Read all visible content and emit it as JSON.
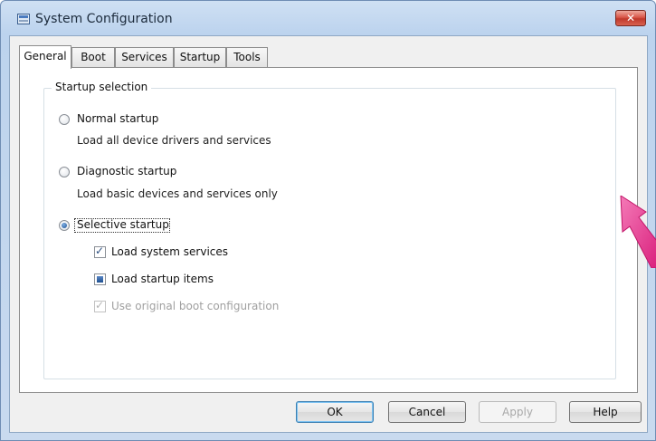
{
  "window": {
    "title": "System Configuration",
    "close_glyph": "✕"
  },
  "tabs": [
    {
      "label": "General",
      "active": true
    },
    {
      "label": "Boot",
      "active": false
    },
    {
      "label": "Services",
      "active": false
    },
    {
      "label": "Startup",
      "active": false
    },
    {
      "label": "Tools",
      "active": false
    }
  ],
  "startup_selection": {
    "title": "Startup selection",
    "normal": {
      "label": "Normal startup",
      "description": "Load all device drivers and services",
      "selected": false
    },
    "diagnostic": {
      "label": "Diagnostic startup",
      "description": "Load basic devices and services only",
      "selected": false
    },
    "selective": {
      "label": "Selective startup",
      "selected": true
    },
    "options": {
      "load_system_services": {
        "label": "Load system services",
        "state": "checked"
      },
      "load_startup_items": {
        "label": "Load startup items",
        "state": "indeterminate"
      },
      "use_original_boot": {
        "label": "Use original boot configuration",
        "state": "checked-disabled"
      }
    }
  },
  "buttons": {
    "ok": "OK",
    "cancel": "Cancel",
    "apply": "Apply",
    "help": "Help"
  },
  "colors": {
    "annotation_arrow": "#e8318f",
    "title_bar": "#bcd3ee",
    "close_button": "#c0392b"
  }
}
